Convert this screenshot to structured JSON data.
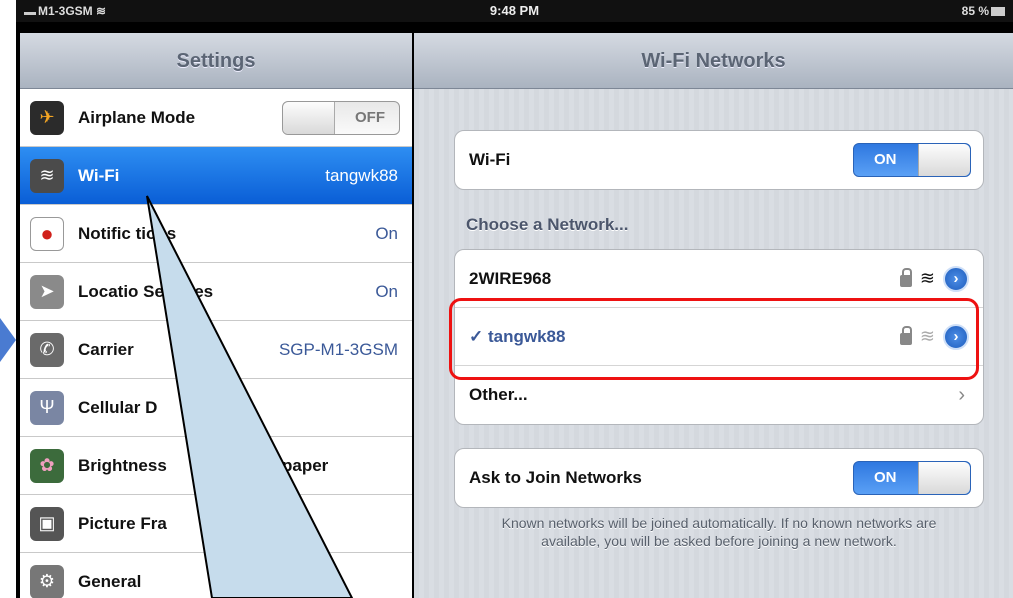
{
  "statusbar": {
    "carrier": "M1-3GSM",
    "time": "9:48 PM",
    "battery": "85 %"
  },
  "left": {
    "title": "Settings",
    "items": [
      {
        "label": "Airplane Mode",
        "value": "OFF",
        "icon": "airplane-icon",
        "color": "#2b2b2b",
        "glyph": "✈"
      },
      {
        "label": "Wi-Fi",
        "value": "tangwk88",
        "icon": "wifi-icon",
        "color": "#4b4b4b",
        "glyph": "≋"
      },
      {
        "label": "Notific  tions",
        "value": "On",
        "icon": "notifications-icon",
        "color": "#c21",
        "glyph": "●"
      },
      {
        "label": "Locatio   Services",
        "value": "On",
        "icon": "location-icon",
        "color": "#7a7a7a",
        "glyph": "➤"
      },
      {
        "label": "Carrier",
        "value": "SGP-M1-3GSM",
        "icon": "phone-icon",
        "color": "#6a6a6a",
        "glyph": "✆"
      },
      {
        "label": "Cellular D",
        "value": "",
        "icon": "antenna-icon",
        "color": "#7a86a3",
        "glyph": "Ψ"
      },
      {
        "label": "Brightness",
        "value": "paper",
        "icon": "flower-icon",
        "color": "#3c6b3c",
        "glyph": "✿"
      },
      {
        "label": "Picture Fra",
        "value": "",
        "icon": "picture-frame-icon",
        "color": "#555",
        "glyph": "▣"
      },
      {
        "label": "General",
        "value": "",
        "icon": "gear-icon",
        "color": "#777",
        "glyph": "⚙"
      }
    ]
  },
  "right": {
    "title": "Wi-Fi Networks",
    "wifi_label": "Wi-Fi",
    "wifi_toggle": "ON",
    "choose_label": "Choose a Network...",
    "networks": [
      {
        "name": "2WIRE968",
        "checked": false,
        "signal": "strong"
      },
      {
        "name": "✓ tangwk88",
        "checked": true,
        "signal": "weak"
      },
      {
        "name": "Other...",
        "checked": false,
        "signal": "none"
      }
    ],
    "ask_label": "Ask to Join Networks",
    "ask_toggle": "ON",
    "footnote": "Known networks will be joined automatically.  If no known networks are available, you will be asked before joining a new network."
  },
  "colors": {
    "selected_row": "#1a72e6",
    "highlight": "#e11111",
    "callout": "#c6dcec"
  }
}
